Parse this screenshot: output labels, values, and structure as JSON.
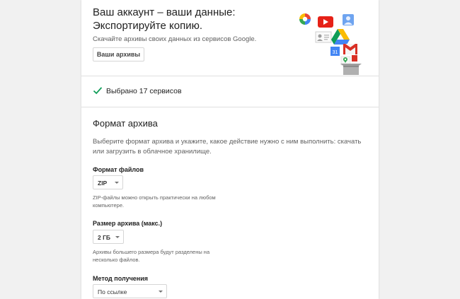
{
  "header": {
    "title": "Ваш аккаунт – ваши данные: Экспортируйте копию.",
    "subtitle": "Скачайте архивы своих данных из сервисов Google.",
    "archives_button": "Ваши архивы",
    "collage_icons": [
      "photos-icon",
      "youtube-icon",
      "profile-icon",
      "contacts-icon",
      "drive-icon",
      "calendar-icon",
      "gmail-icon",
      "maps-icon",
      "box-icon"
    ],
    "calendar_number": "31"
  },
  "selected": {
    "text": "Выбрано 17 сервисов",
    "icon": "check-icon",
    "color": "#0f9d58"
  },
  "format": {
    "title": "Формат архива",
    "description": "Выберите формат архива и укажите, какое действие нужно с ним выполнить: скачать или загрузить в облачное хранилище.",
    "file_type": {
      "label": "Формат файлов",
      "value": "ZIP",
      "help": "ZIP-файлы можно открыть практически на любом компьютере."
    },
    "archive_size": {
      "label": "Размер архива (макс.)",
      "value": "2 ГБ",
      "help": "Архивы большего размера будут разделены на несколько файлов."
    },
    "delivery": {
      "label": "Метод получения",
      "value": "По ссылке"
    }
  }
}
